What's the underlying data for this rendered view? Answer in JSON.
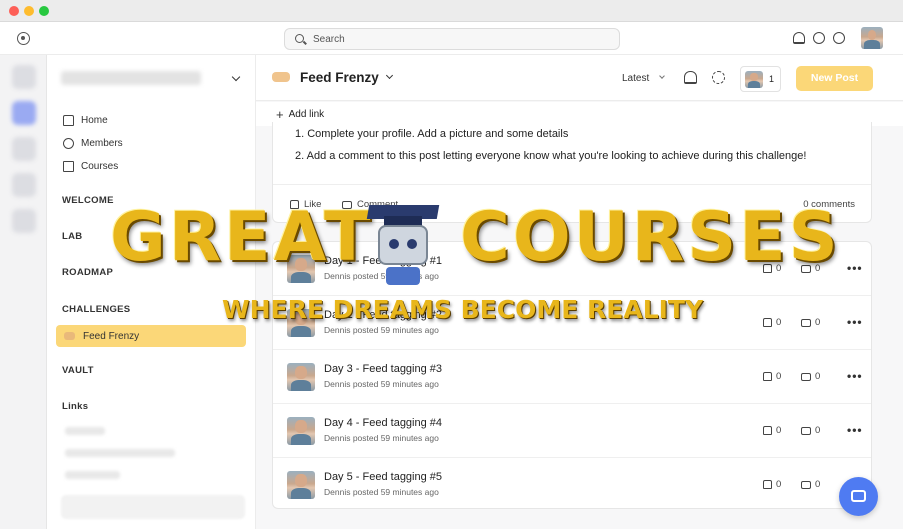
{
  "search": {
    "placeholder": "Search"
  },
  "feed": {
    "title": "Feed Frenzy",
    "sort_label": "Latest",
    "member_count": "1",
    "new_post_label": "New Post",
    "add_link_label": "Add link"
  },
  "sidebar": {
    "nav": [
      {
        "label": "Home",
        "icon": "home-icon"
      },
      {
        "label": "Members",
        "icon": "members-icon"
      },
      {
        "label": "Courses",
        "icon": "courses-icon"
      }
    ],
    "sections": {
      "welcome": "WELCOME",
      "lab": "LAB",
      "roadmap": "ROADMAP",
      "challenges": "CHALLENGES",
      "vault": "VAULT",
      "links": "Links"
    },
    "active_item": "Feed Frenzy"
  },
  "post": {
    "lines": [
      "1. Complete your profile. Add a picture and some details",
      "2. Add a comment to this post letting everyone know what you're looking to achieve during this challenge!"
    ],
    "like_label": "Like",
    "comment_label": "Comment",
    "comments_count": "0 comments"
  },
  "rows": [
    {
      "title": "Day 1 - Feed tagging #1",
      "meta": "Dennis posted 59 minutes ago",
      "likes": "0",
      "comments": "0"
    },
    {
      "title": "Day 2 - Feed tagging #2",
      "meta": "Dennis posted 59 minutes ago",
      "likes": "0",
      "comments": "0"
    },
    {
      "title": "Day 3 - Feed tagging #3",
      "meta": "Dennis posted 59 minutes ago",
      "likes": "0",
      "comments": "0"
    },
    {
      "title": "Day 4 - Feed tagging #4",
      "meta": "Dennis posted 59 minutes ago",
      "likes": "0",
      "comments": "0"
    },
    {
      "title": "Day 5 - Feed tagging #5",
      "meta": "Dennis posted 59 minutes ago",
      "likes": "0",
      "comments": "0"
    }
  ],
  "watermark": {
    "title_left": "GREAT",
    "title_right": "COURSES",
    "subtitle": "WHERE DREAMS BECOME REALITY"
  },
  "colors": {
    "accent": "#fbd778",
    "chat_button": "#4f7bf2",
    "watermark_gold": "#e8b61b"
  }
}
